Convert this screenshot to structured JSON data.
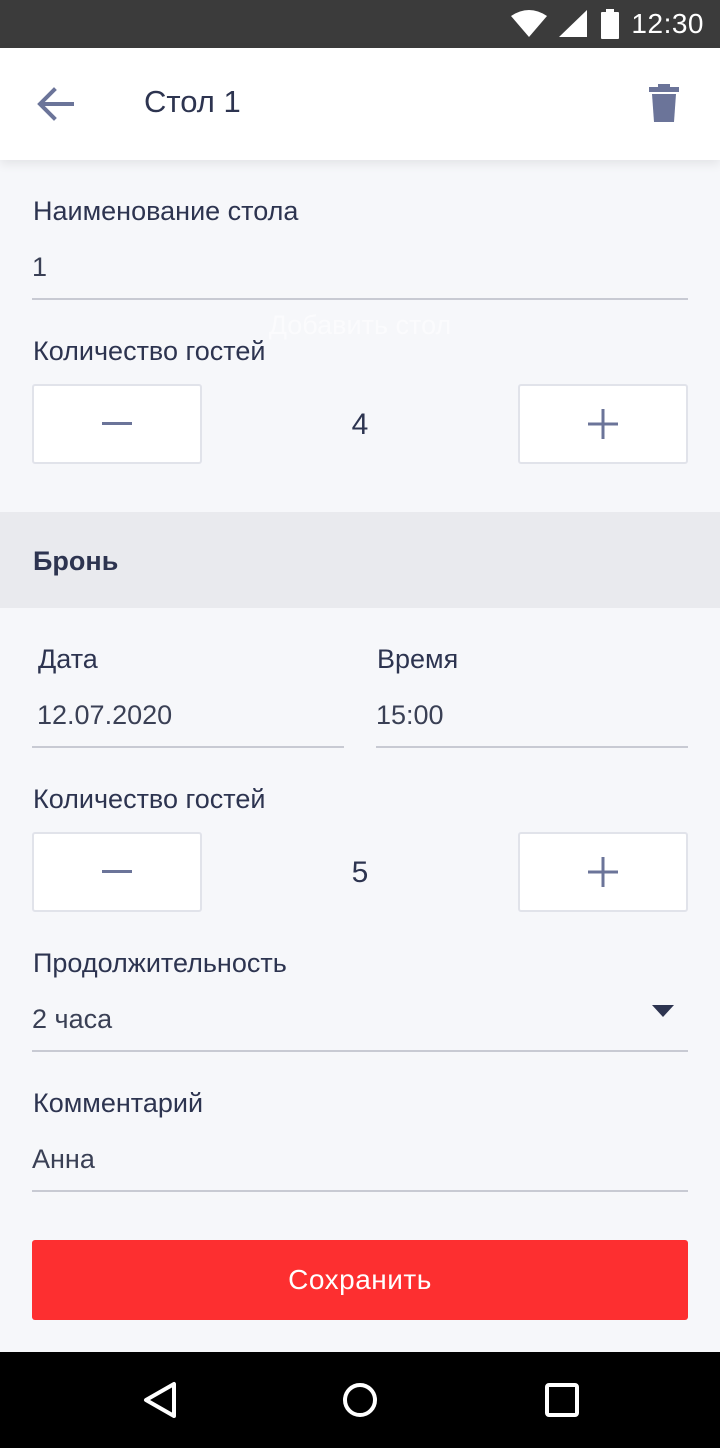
{
  "status_bar": {
    "time": "12:30"
  },
  "app_bar": {
    "title": "Стол 1"
  },
  "table": {
    "name_label": "Наименование стола",
    "name_value": "1",
    "ghost_text": "Добавить стол",
    "guests_label": "Количество гостей",
    "guests_value": "4"
  },
  "booking": {
    "section_title": "Бронь",
    "date_label": "Дата",
    "date_value": "12.07.2020",
    "time_label": "Время",
    "time_value": "15:00",
    "guests_label": "Количество гостей",
    "guests_value": "5",
    "duration_label": "Продолжительность",
    "duration_value": "2 часа",
    "comment_label": "Комментарий",
    "comment_value": "Анна"
  },
  "actions": {
    "save_label": "Сохранить"
  },
  "icons": {
    "back": "arrow-left-icon",
    "delete": "trash-icon",
    "minus": "minus-icon",
    "plus": "plus-icon",
    "dropdown": "caret-down-icon",
    "nav_back": "triangle-back-icon",
    "nav_home": "circle-home-icon",
    "nav_recents": "square-recents-icon"
  },
  "colors": {
    "accent": "#fd2f30",
    "icon": "#6b7499",
    "text": "#2d3450",
    "background": "#f6f7fa"
  }
}
